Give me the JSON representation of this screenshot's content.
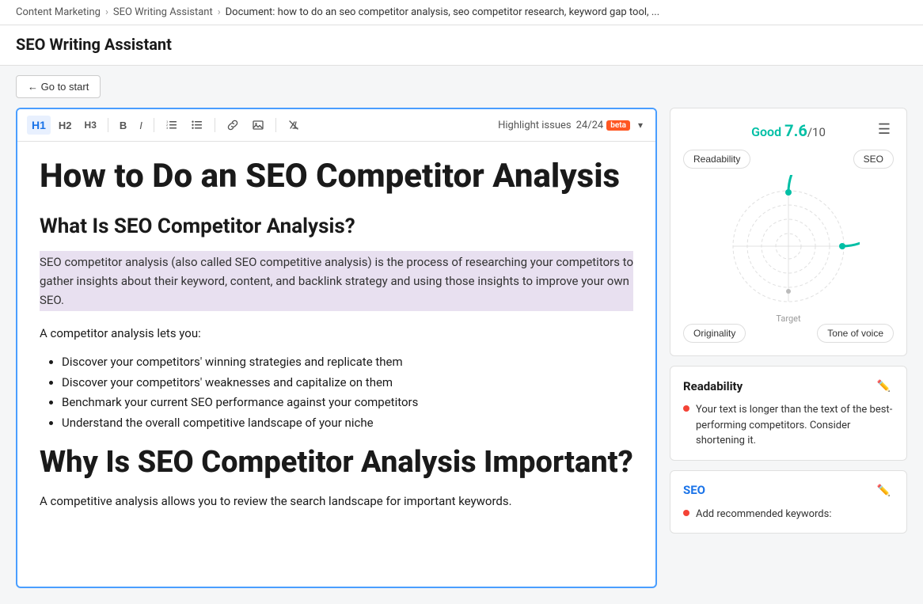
{
  "breadcrumb": {
    "items": [
      {
        "label": "Content Marketing",
        "href": "#"
      },
      {
        "label": "SEO Writing Assistant",
        "href": "#"
      },
      {
        "label": "Document: how to do an seo competitor analysis, seo competitor research, keyword gap tool, ...",
        "href": "#"
      }
    ]
  },
  "page_title": "SEO Writing Assistant",
  "toolbar": {
    "go_to_start": "← Go to start",
    "h1": "H1",
    "h2": "H2",
    "h3": "H3",
    "bold": "B",
    "italic": "I",
    "highlight_label": "Highlight issues",
    "highlight_count": "24/24",
    "beta_label": "beta"
  },
  "editor": {
    "doc_title": "How to Do an SEO Competitor Analysis",
    "section1_heading": "What Is SEO Competitor Analysis?",
    "section1_highlighted_para": "SEO competitor analysis (also called SEO competitive analysis) is the process of researching your competitors to gather insights about their keyword, content, and backlink strategy and using those insights to improve your own SEO.",
    "section1_para": "A competitor analysis lets you:",
    "section1_list": [
      "Discover your competitors' winning strategies and replicate them",
      "Discover your competitors' weaknesses and capitalize on them",
      "Benchmark your current SEO performance against your competitors",
      "Understand the overall competitive landscape of your niche"
    ],
    "section2_heading": "Why Is SEO Competitor Analysis Important?",
    "section2_para": "A competitive analysis allows you to review the search landscape for important keywords."
  },
  "score_panel": {
    "quality_label": "Good",
    "score": "7.6",
    "denom": "/10",
    "radar_labels_top": [
      "Readability",
      "SEO"
    ],
    "radar_labels_bottom": [
      "Originality",
      "Tone of voice"
    ],
    "target_label": "Target"
  },
  "readability_card": {
    "title": "Readability",
    "issue": "Your text is longer than the text of the best-performing competitors. Consider shortening it."
  },
  "seo_card": {
    "title": "SEO",
    "issue": "Add recommended keywords:"
  }
}
